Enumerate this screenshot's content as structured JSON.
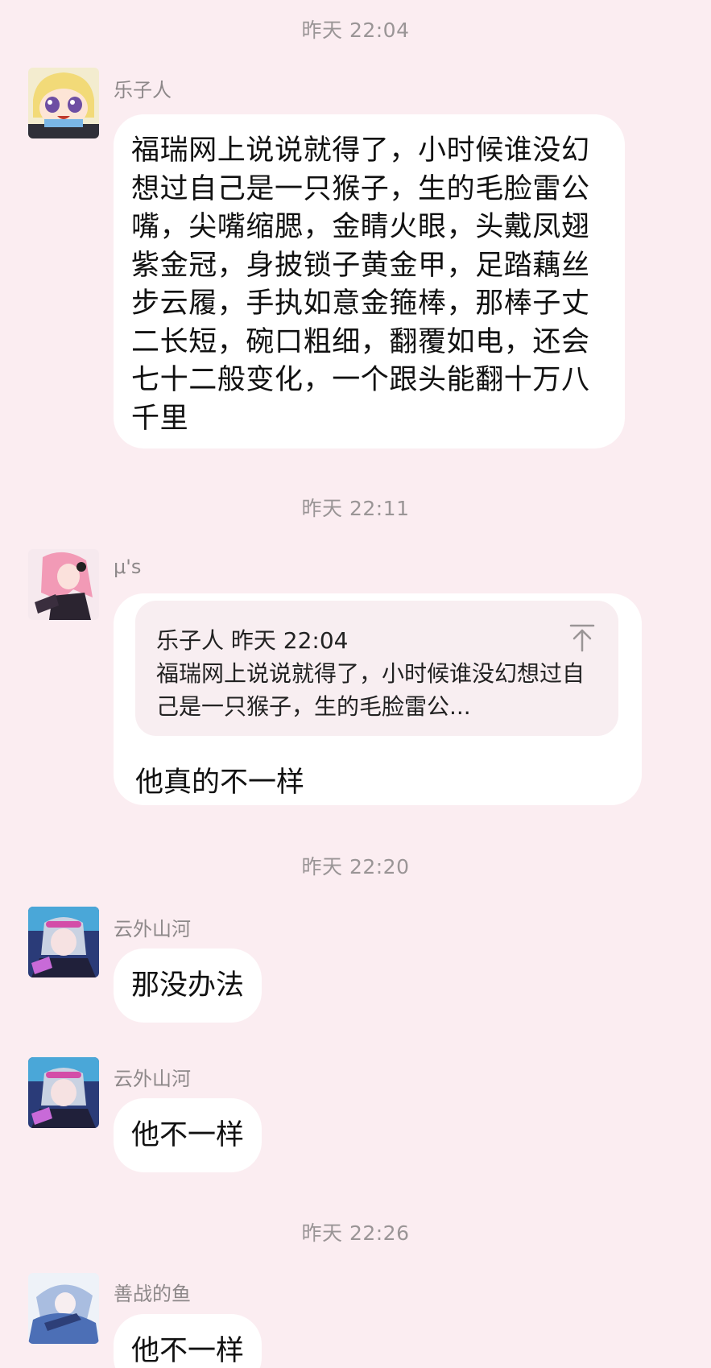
{
  "timestamps": [
    "昨天 22:04",
    "昨天 22:11",
    "昨天 22:20",
    "昨天 22:26"
  ],
  "messages": [
    {
      "sender": "乐子人",
      "text": "福瑞网上说说就得了，小时候谁没幻想过自己是一只猴子，生的毛脸雷公嘴，尖嘴缩腮，金睛火眼，头戴凤翅紫金冠，身披锁子黄金甲，足踏藕丝步云履，手执如意金箍棒，那棒子丈二长短，碗口粗细，翻覆如电，还会七十二般变化，一个跟头能翻十万八千里"
    },
    {
      "sender": "μ's",
      "quote": {
        "header": "乐子人 昨天 22:04",
        "text": "福瑞网上说说就得了，小时候谁没幻想过自己是一只猴子，生的毛脸雷公..."
      },
      "text": "他真的不一样"
    },
    {
      "sender": "云外山河",
      "text": "那没办法"
    },
    {
      "sender": "云外山河",
      "text": "他不一样"
    },
    {
      "sender": "善战的鱼",
      "text": "他不一样"
    }
  ],
  "icons": {
    "quote_jump": "arrow-up-to-top-icon"
  },
  "colors": {
    "background": "#fbedf1",
    "bubble": "#ffffff",
    "quote_background": "#f8eef1",
    "timestamp": "#9a9596"
  }
}
